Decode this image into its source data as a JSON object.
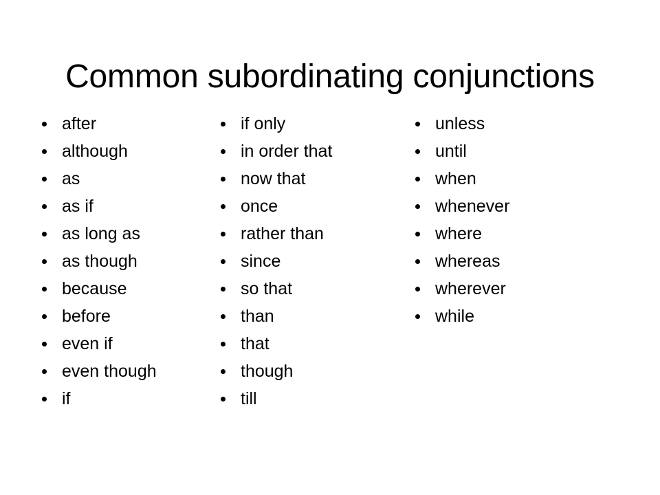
{
  "slide": {
    "title": "Common subordinating conjunctions",
    "background_color": "#ffffff",
    "text_color": "#000000",
    "bullet_glyph": "bullet-dot",
    "columns": [
      {
        "name": "column-1",
        "items": [
          "after",
          "although",
          "as",
          "as if",
          "as long as",
          "as though",
          "because",
          "before",
          "even if",
          "even though",
          "if"
        ]
      },
      {
        "name": "column-2",
        "items": [
          "if only",
          "in order that",
          "now that",
          "once",
          "rather than",
          "since",
          "so that",
          "than",
          "that",
          "though",
          "till"
        ]
      },
      {
        "name": "column-3",
        "items": [
          "unless",
          "until",
          "when",
          "whenever",
          "where",
          "whereas",
          "wherever",
          "while"
        ]
      }
    ]
  }
}
